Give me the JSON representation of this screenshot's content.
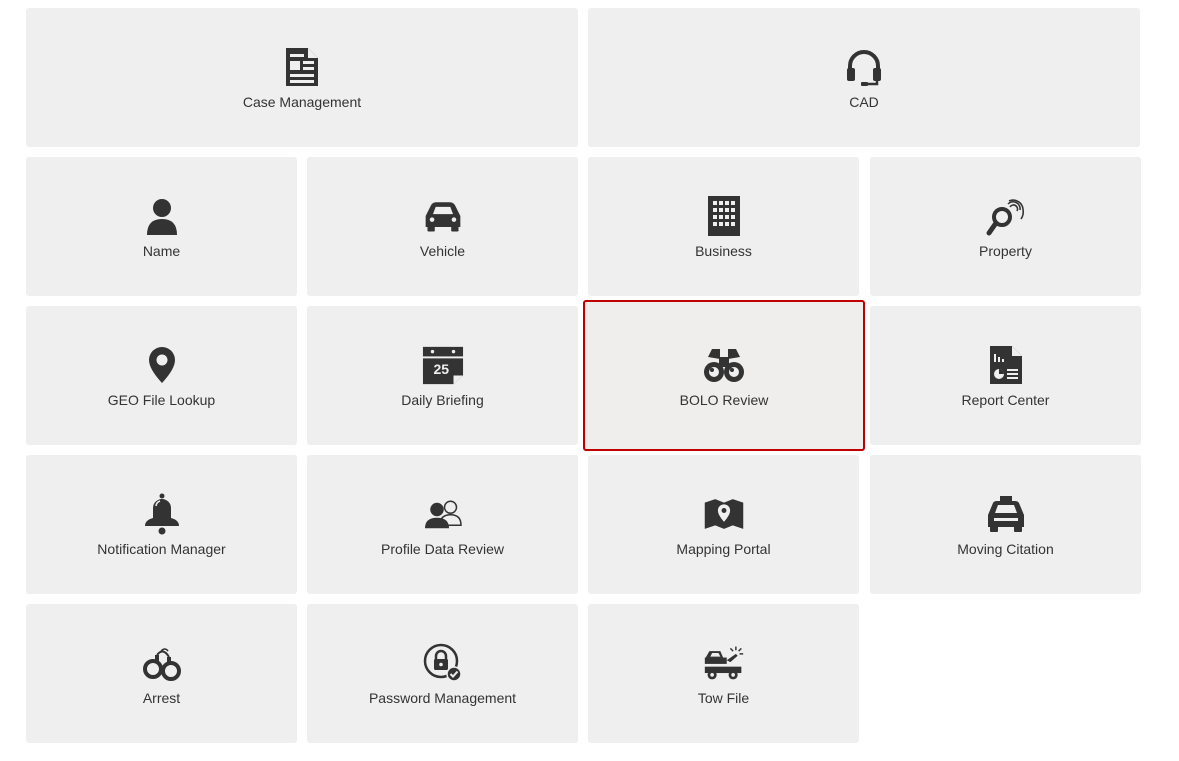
{
  "tiles": {
    "case_management": {
      "label": "Case Management",
      "icon": "document-icon"
    },
    "cad": {
      "label": "CAD",
      "icon": "headset-icon"
    },
    "name": {
      "label": "Name",
      "icon": "person-icon"
    },
    "vehicle": {
      "label": "Vehicle",
      "icon": "car-icon"
    },
    "business": {
      "label": "Business",
      "icon": "building-icon"
    },
    "property": {
      "label": "Property",
      "icon": "fingerprint-magnifier-icon"
    },
    "geo_file_lookup": {
      "label": "GEO File Lookup",
      "icon": "map-pin-icon"
    },
    "daily_briefing": {
      "label": "Daily Briefing",
      "icon": "calendar-icon",
      "calendar_day": "25"
    },
    "bolo_review": {
      "label": "BOLO Review",
      "icon": "binoculars-icon",
      "selected": true
    },
    "report_center": {
      "label": "Report Center",
      "icon": "report-icon"
    },
    "notification_manager": {
      "label": "Notification Manager",
      "icon": "bell-icon"
    },
    "profile_data_review": {
      "label": "Profile Data Review",
      "icon": "users-icon"
    },
    "mapping_portal": {
      "label": "Mapping Portal",
      "icon": "map-icon"
    },
    "moving_citation": {
      "label": "Moving Citation",
      "icon": "police-car-icon"
    },
    "arrest": {
      "label": "Arrest",
      "icon": "handcuffs-icon"
    },
    "password_management": {
      "label": "Password Management",
      "icon": "lock-badge-icon"
    },
    "tow_file": {
      "label": "Tow File",
      "icon": "tow-truck-icon"
    }
  },
  "colors": {
    "tile_background": "#efefef",
    "icon": "#333333",
    "selected_border": "#c00000"
  }
}
